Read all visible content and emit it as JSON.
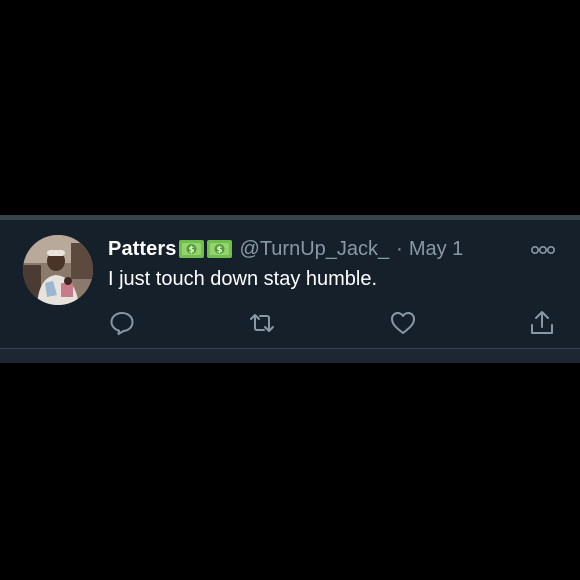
{
  "tweet": {
    "display_name": "Patters",
    "name_emojis": [
      "money-with-dollar-sign-emoji",
      "money-with-dollar-sign-emoji"
    ],
    "handle": "@TurnUp_Jack_",
    "separator": "·",
    "date": "May 1",
    "text": "I just touch down stay humble."
  },
  "actions": {
    "reply": "reply-icon",
    "retweet": "retweet-icon",
    "like": "heart-icon",
    "share": "share-icon",
    "more": "more-options-icon"
  },
  "colors": {
    "background": "#000000",
    "tweet_background": "#15202b",
    "primary_text": "#ffffff",
    "secondary_text": "#8899a6",
    "border": "#38444d",
    "money_green": "#6fbf4c"
  }
}
